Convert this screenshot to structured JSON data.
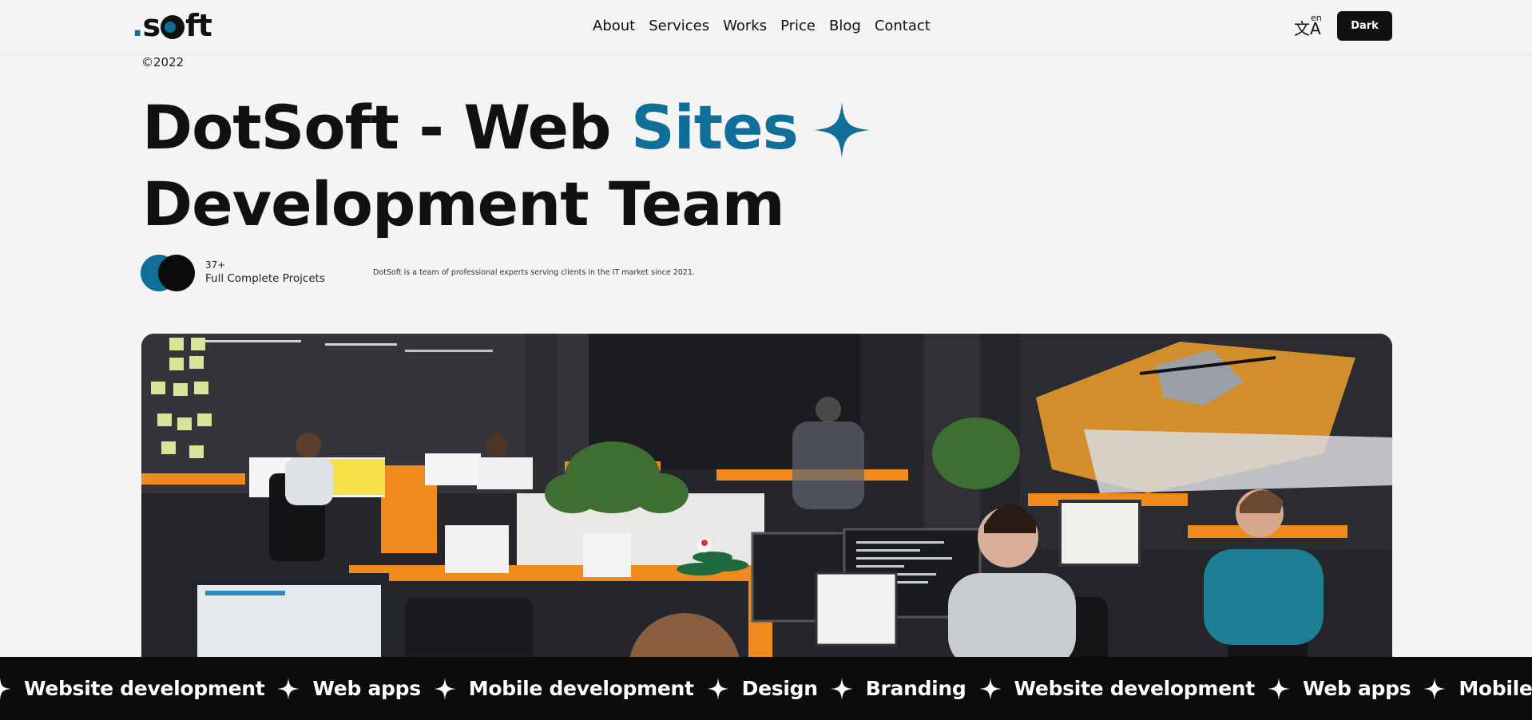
{
  "header": {
    "logo": ".soft",
    "nav": [
      "About",
      "Services",
      "Works",
      "Price",
      "Blog",
      "Contact"
    ],
    "lang_glyph": "文A",
    "lang_code": "en",
    "theme_button": "Dark"
  },
  "hero": {
    "year": "©2022",
    "title_part1": "DotSoft - Web ",
    "title_accent": "Sites",
    "title_line2": "Development Team",
    "projects_count": "37+",
    "projects_label": "Full Complete Projcets",
    "tagline": "DotSoft is a team of professional experts serving clients in the IT market since 2021."
  },
  "marquee": {
    "items": [
      "Website development",
      "Web apps",
      "Mobile development",
      "Design",
      "Branding",
      "Website development",
      "Web apps",
      "Mobile development"
    ]
  },
  "colors": {
    "accent": "#0f6f98",
    "dark": "#0c0c0c",
    "background": "#f4f4f2"
  },
  "icons": {
    "language": "translate-icon",
    "star": "sparkle-icon"
  }
}
